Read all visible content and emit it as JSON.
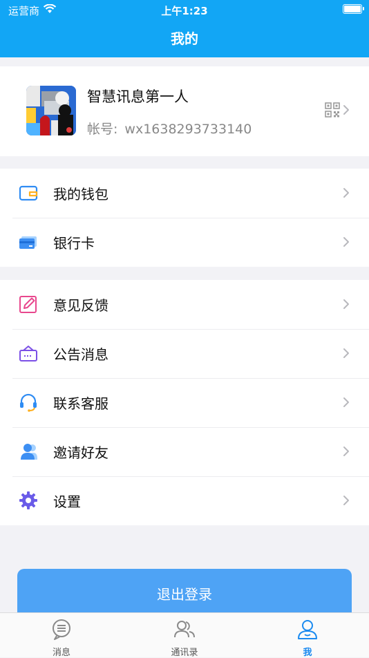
{
  "status": {
    "carrier": "运营商",
    "time": "上午1:23"
  },
  "header": {
    "title": "我的"
  },
  "profile": {
    "nickname": "智慧讯息第一人",
    "account_label": "帐号:",
    "account_id": "wx1638293733140"
  },
  "group1": [
    {
      "label": "我的钱包",
      "icon": "wallet-icon"
    },
    {
      "label": "银行卡",
      "icon": "bank-card-icon"
    }
  ],
  "group2": [
    {
      "label": "意见反馈",
      "icon": "feedback-edit-icon"
    },
    {
      "label": "公告消息",
      "icon": "announcement-icon"
    },
    {
      "label": "联系客服",
      "icon": "headset-icon"
    },
    {
      "label": "邀请好友",
      "icon": "invite-user-icon"
    },
    {
      "label": "设置",
      "icon": "settings-gear-icon"
    }
  ],
  "logout_label": "退出登录",
  "tabs": [
    {
      "label": "消息",
      "icon": "message-icon",
      "active": false
    },
    {
      "label": "通讯录",
      "icon": "contacts-icon",
      "active": false
    },
    {
      "label": "我",
      "icon": "me-icon",
      "active": true
    }
  ],
  "colors": {
    "brand": "#12a6f5",
    "button": "#4ea3f5",
    "active_tab": "#1a8af0"
  }
}
